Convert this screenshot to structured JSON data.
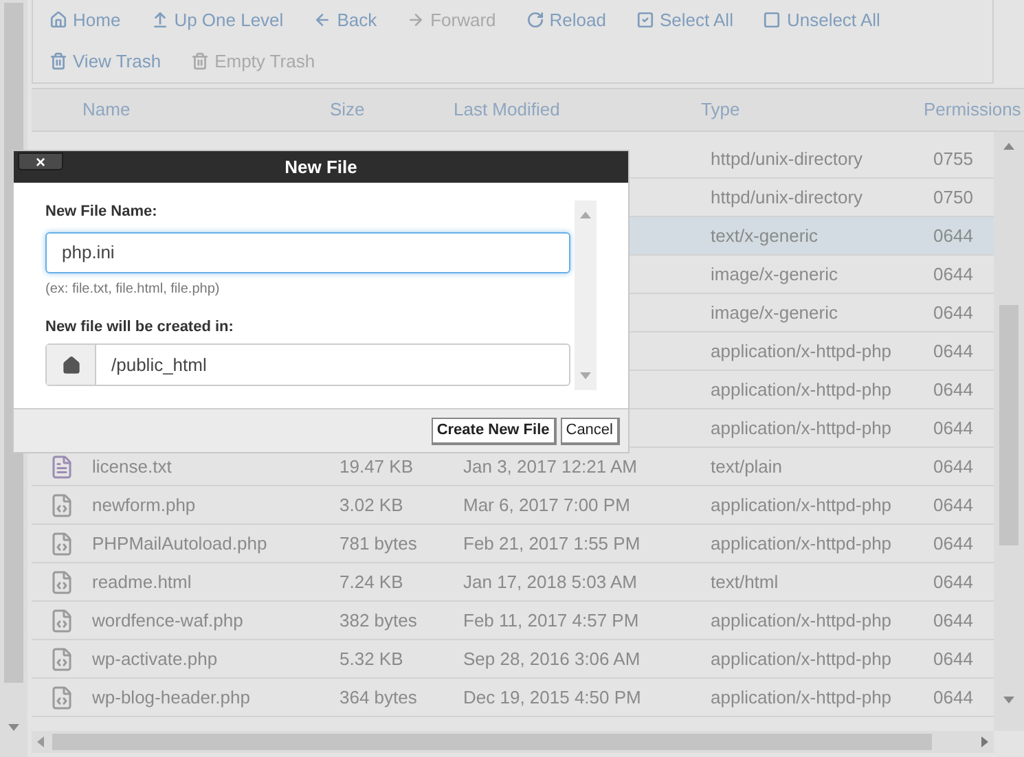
{
  "toolbar": [
    {
      "label": "Home",
      "kind": "home",
      "disabled": false
    },
    {
      "label": "Up One Level",
      "kind": "up",
      "disabled": false
    },
    {
      "label": "Back",
      "kind": "back",
      "disabled": false
    },
    {
      "label": "Forward",
      "kind": "forward",
      "disabled": true
    },
    {
      "label": "Reload",
      "kind": "reload",
      "disabled": false
    },
    {
      "label": "Select All",
      "kind": "check",
      "disabled": false
    },
    {
      "label": "Unselect All",
      "kind": "square",
      "disabled": false
    },
    {
      "label": "View Trash",
      "kind": "trash",
      "disabled": false
    },
    {
      "label": "Empty Trash",
      "kind": "trash",
      "disabled": true
    }
  ],
  "table": {
    "columns": [
      "Name",
      "Size",
      "Last Modified",
      "Type",
      "Permissions"
    ],
    "rows": [
      {
        "type": "httpd/unix-directory",
        "permissions": "0755",
        "selected": false
      },
      {
        "type": "httpd/unix-directory",
        "permissions": "0750",
        "selected": false
      },
      {
        "type": "text/x-generic",
        "permissions": "0644",
        "selected": true
      },
      {
        "type": "image/x-generic",
        "permissions": "0644",
        "selected": false
      },
      {
        "type": "image/x-generic",
        "permissions": "0644",
        "selected": false
      },
      {
        "type": "application/x-httpd-php",
        "permissions": "0644",
        "selected": false
      },
      {
        "type": "application/x-httpd-php",
        "permissions": "0644",
        "selected": false
      },
      {
        "type": "application/x-httpd-php",
        "permissions": "0644",
        "selected": false
      },
      {
        "kind": "text",
        "name": "license.txt",
        "size": "19.47 KB",
        "modified": "Jan 3, 2017 12:21 AM",
        "type": "text/plain",
        "permissions": "0644",
        "selected": false
      },
      {
        "kind": "code",
        "name": "newform.php",
        "size": "3.02 KB",
        "modified": "Mar 6, 2017 7:00 PM",
        "type": "application/x-httpd-php",
        "permissions": "0644",
        "selected": false
      },
      {
        "kind": "code",
        "name": "PHPMailAutoload.php",
        "size": "781 bytes",
        "modified": "Feb 21, 2017 1:55 PM",
        "type": "application/x-httpd-php",
        "permissions": "0644",
        "selected": false
      },
      {
        "kind": "code",
        "name": "readme.html",
        "size": "7.24 KB",
        "modified": "Jan 17, 2018 5:03 AM",
        "type": "text/html",
        "permissions": "0644",
        "selected": false
      },
      {
        "kind": "code",
        "name": "wordfence-waf.php",
        "size": "382 bytes",
        "modified": "Feb 11, 2017 4:57 PM",
        "type": "application/x-httpd-php",
        "permissions": "0644",
        "selected": false
      },
      {
        "kind": "code",
        "name": "wp-activate.php",
        "size": "5.32 KB",
        "modified": "Sep 28, 2016 3:06 AM",
        "type": "application/x-httpd-php",
        "permissions": "0644",
        "selected": false
      },
      {
        "kind": "code",
        "name": "wp-blog-header.php",
        "size": "364 bytes",
        "modified": "Dec 19, 2015 4:50 PM",
        "type": "application/x-httpd-php",
        "permissions": "0644",
        "selected": false
      }
    ]
  },
  "dialog": {
    "title": "New File",
    "close": "×",
    "name_label": "New File Name:",
    "name_value": "php.ini",
    "hint": "(ex: file.txt, file.html, file.php)",
    "path_label": "New file will be created in:",
    "path_value": "/public_html",
    "buttons": [
      "Create New File",
      "Cancel"
    ]
  }
}
